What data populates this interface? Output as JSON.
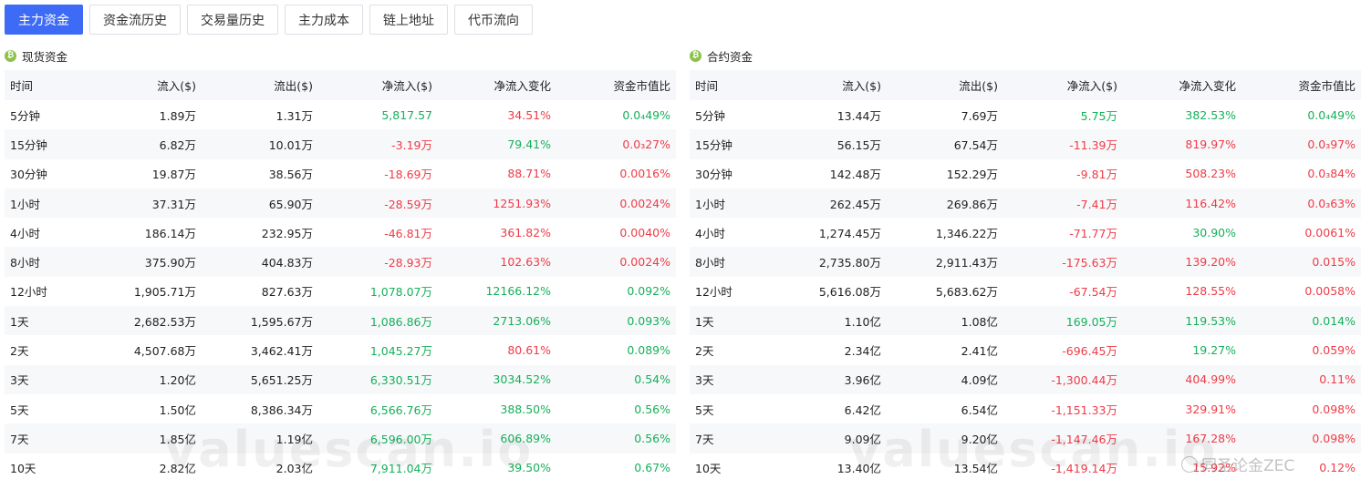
{
  "tabs": [
    "主力资金",
    "资金流历史",
    "交易量历史",
    "主力成本",
    "链上地址",
    "代币流向"
  ],
  "colors": {
    "accent": "#3d6bf5",
    "positive": "#16b05a",
    "negative": "#ef3b47"
  },
  "spot": {
    "title": "现货资金",
    "icon": "bitcoin-icon",
    "headers": [
      "时间",
      "流入($)",
      "流出($)",
      "净流入($)",
      "净流入变化",
      "资金市值比"
    ],
    "rows": [
      {
        "time": "5分钟",
        "inflow": "1.89万",
        "outflow": "1.31万",
        "net": "5,817.57",
        "net_color": "green",
        "change": "34.51%",
        "change_color": "red",
        "ratio": "0.0₄49%",
        "ratio_color": "green"
      },
      {
        "time": "15分钟",
        "inflow": "6.82万",
        "outflow": "10.01万",
        "net": "-3.19万",
        "net_color": "red",
        "change": "79.41%",
        "change_color": "green",
        "ratio": "0.0₃27%",
        "ratio_color": "red"
      },
      {
        "time": "30分钟",
        "inflow": "19.87万",
        "outflow": "38.56万",
        "net": "-18.69万",
        "net_color": "red",
        "change": "88.71%",
        "change_color": "red",
        "ratio": "0.0016%",
        "ratio_color": "red"
      },
      {
        "time": "1小时",
        "inflow": "37.31万",
        "outflow": "65.90万",
        "net": "-28.59万",
        "net_color": "red",
        "change": "1251.93%",
        "change_color": "red",
        "ratio": "0.0024%",
        "ratio_color": "red"
      },
      {
        "time": "4小时",
        "inflow": "186.14万",
        "outflow": "232.95万",
        "net": "-46.81万",
        "net_color": "red",
        "change": "361.82%",
        "change_color": "red",
        "ratio": "0.0040%",
        "ratio_color": "red"
      },
      {
        "time": "8小时",
        "inflow": "375.90万",
        "outflow": "404.83万",
        "net": "-28.93万",
        "net_color": "red",
        "change": "102.63%",
        "change_color": "red",
        "ratio": "0.0024%",
        "ratio_color": "red"
      },
      {
        "time": "12小时",
        "inflow": "1,905.71万",
        "outflow": "827.63万",
        "net": "1,078.07万",
        "net_color": "green",
        "change": "12166.12%",
        "change_color": "green",
        "ratio": "0.092%",
        "ratio_color": "green"
      },
      {
        "time": "1天",
        "inflow": "2,682.53万",
        "outflow": "1,595.67万",
        "net": "1,086.86万",
        "net_color": "green",
        "change": "2713.06%",
        "change_color": "green",
        "ratio": "0.093%",
        "ratio_color": "green"
      },
      {
        "time": "2天",
        "inflow": "4,507.68万",
        "outflow": "3,462.41万",
        "net": "1,045.27万",
        "net_color": "green",
        "change": "80.61%",
        "change_color": "red",
        "ratio": "0.089%",
        "ratio_color": "green"
      },
      {
        "time": "3天",
        "inflow": "1.20亿",
        "outflow": "5,651.25万",
        "net": "6,330.51万",
        "net_color": "green",
        "change": "3034.52%",
        "change_color": "green",
        "ratio": "0.54%",
        "ratio_color": "green"
      },
      {
        "time": "5天",
        "inflow": "1.50亿",
        "outflow": "8,386.34万",
        "net": "6,566.76万",
        "net_color": "green",
        "change": "388.50%",
        "change_color": "green",
        "ratio": "0.56%",
        "ratio_color": "green"
      },
      {
        "time": "7天",
        "inflow": "1.85亿",
        "outflow": "1.19亿",
        "net": "6,596.00万",
        "net_color": "green",
        "change": "606.89%",
        "change_color": "green",
        "ratio": "0.56%",
        "ratio_color": "green"
      },
      {
        "time": "10天",
        "inflow": "2.82亿",
        "outflow": "2.03亿",
        "net": "7,911.04万",
        "net_color": "green",
        "change": "39.50%",
        "change_color": "green",
        "ratio": "0.67%",
        "ratio_color": "green"
      }
    ]
  },
  "futures": {
    "title": "合约资金",
    "icon": "bitcoin-icon",
    "headers": [
      "时间",
      "流入($)",
      "流出($)",
      "净流入($)",
      "净流入变化",
      "资金市值比"
    ],
    "rows": [
      {
        "time": "5分钟",
        "inflow": "13.44万",
        "outflow": "7.69万",
        "net": "5.75万",
        "net_color": "green",
        "change": "382.53%",
        "change_color": "green",
        "ratio": "0.0₄49%",
        "ratio_color": "green"
      },
      {
        "time": "15分钟",
        "inflow": "56.15万",
        "outflow": "67.54万",
        "net": "-11.39万",
        "net_color": "red",
        "change": "819.97%",
        "change_color": "red",
        "ratio": "0.0₃97%",
        "ratio_color": "red"
      },
      {
        "time": "30分钟",
        "inflow": "142.48万",
        "outflow": "152.29万",
        "net": "-9.81万",
        "net_color": "red",
        "change": "508.23%",
        "change_color": "red",
        "ratio": "0.0₃84%",
        "ratio_color": "red"
      },
      {
        "time": "1小时",
        "inflow": "262.45万",
        "outflow": "269.86万",
        "net": "-7.41万",
        "net_color": "red",
        "change": "116.42%",
        "change_color": "red",
        "ratio": "0.0₃63%",
        "ratio_color": "red"
      },
      {
        "time": "4小时",
        "inflow": "1,274.45万",
        "outflow": "1,346.22万",
        "net": "-71.77万",
        "net_color": "red",
        "change": "30.90%",
        "change_color": "green",
        "ratio": "0.0061%",
        "ratio_color": "red"
      },
      {
        "time": "8小时",
        "inflow": "2,735.80万",
        "outflow": "2,911.43万",
        "net": "-175.63万",
        "net_color": "red",
        "change": "139.20%",
        "change_color": "red",
        "ratio": "0.015%",
        "ratio_color": "red"
      },
      {
        "time": "12小时",
        "inflow": "5,616.08万",
        "outflow": "5,683.62万",
        "net": "-67.54万",
        "net_color": "red",
        "change": "128.55%",
        "change_color": "red",
        "ratio": "0.0058%",
        "ratio_color": "red"
      },
      {
        "time": "1天",
        "inflow": "1.10亿",
        "outflow": "1.08亿",
        "net": "169.05万",
        "net_color": "green",
        "change": "119.53%",
        "change_color": "green",
        "ratio": "0.014%",
        "ratio_color": "green"
      },
      {
        "time": "2天",
        "inflow": "2.34亿",
        "outflow": "2.41亿",
        "net": "-696.45万",
        "net_color": "red",
        "change": "19.27%",
        "change_color": "green",
        "ratio": "0.059%",
        "ratio_color": "red"
      },
      {
        "time": "3天",
        "inflow": "3.96亿",
        "outflow": "4.09亿",
        "net": "-1,300.44万",
        "net_color": "red",
        "change": "404.99%",
        "change_color": "red",
        "ratio": "0.11%",
        "ratio_color": "red"
      },
      {
        "time": "5天",
        "inflow": "6.42亿",
        "outflow": "6.54亿",
        "net": "-1,151.33万",
        "net_color": "red",
        "change": "329.91%",
        "change_color": "red",
        "ratio": "0.098%",
        "ratio_color": "red"
      },
      {
        "time": "7天",
        "inflow": "9.09亿",
        "outflow": "9.20亿",
        "net": "-1,147.46万",
        "net_color": "red",
        "change": "167.28%",
        "change_color": "red",
        "ratio": "0.098%",
        "ratio_color": "red"
      },
      {
        "time": "10天",
        "inflow": "13.40亿",
        "outflow": "13.54亿",
        "net": "-1,419.14万",
        "net_color": "red",
        "change": "15.92%",
        "change_color": "red",
        "ratio": "0.12%",
        "ratio_color": "red"
      }
    ]
  },
  "watermarks": {
    "site": "valuescan.io",
    "author": "同圣论金ZEC"
  }
}
